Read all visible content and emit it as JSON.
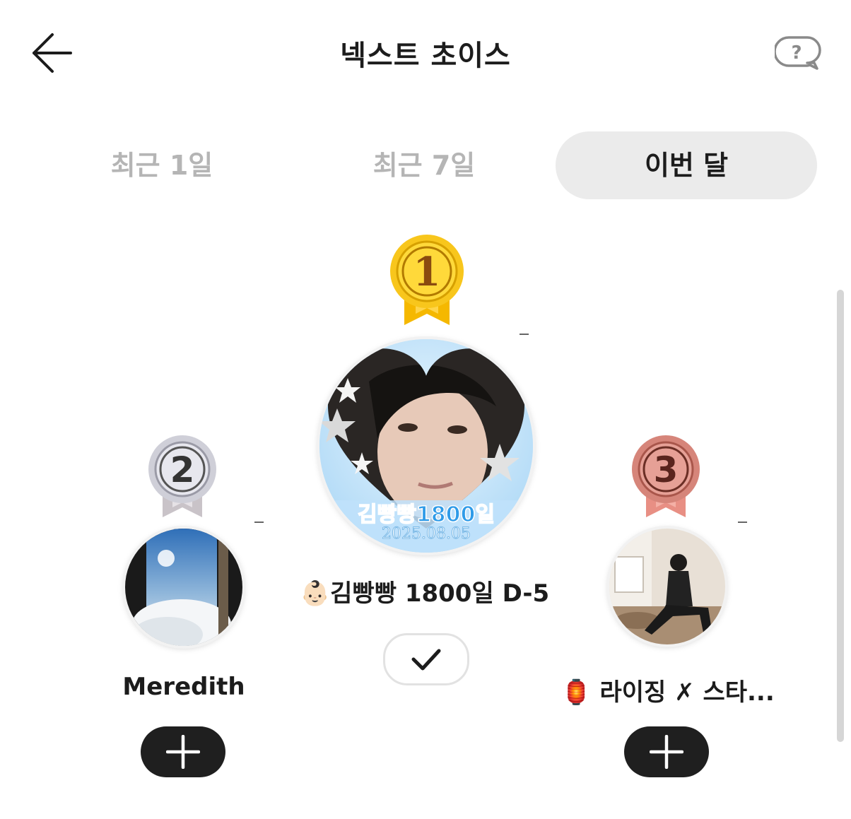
{
  "header": {
    "title": "넥스트 초이스",
    "back_icon": "arrow-left-icon",
    "help_icon": "question-bubble-icon"
  },
  "tabs": [
    {
      "label": "최근 1일",
      "active": false
    },
    {
      "label": "최근 7일",
      "active": false
    },
    {
      "label": "이번 달",
      "active": true
    }
  ],
  "ranking": {
    "first": {
      "rank": "1",
      "name": "김빵빵 1800일 D-5",
      "emoji": "👶🏻",
      "avatar_caption": "김빵빵1800일",
      "avatar_date": "2025.08.05",
      "action_icon": "checkmark-icon",
      "selected": true
    },
    "second": {
      "rank": "2",
      "name": "Meredith",
      "action_icon": "plus-icon"
    },
    "third": {
      "rank": "3",
      "name": "라이징 ✗ 스타...",
      "emoji": "🏮",
      "action_icon": "plus-icon"
    }
  },
  "colors": {
    "gold": "#f3c11a",
    "silver": "#c8c8d4",
    "bronze": "#d6857a",
    "ribbon_gold": "#f5b800",
    "ribbon_silver": "#c9c3c8",
    "ribbon_bronze": "#e88f84",
    "button_dark": "#1f1f1f",
    "tab_active_bg": "#ebebeb",
    "tab_inactive_text": "#b5b5b5"
  }
}
